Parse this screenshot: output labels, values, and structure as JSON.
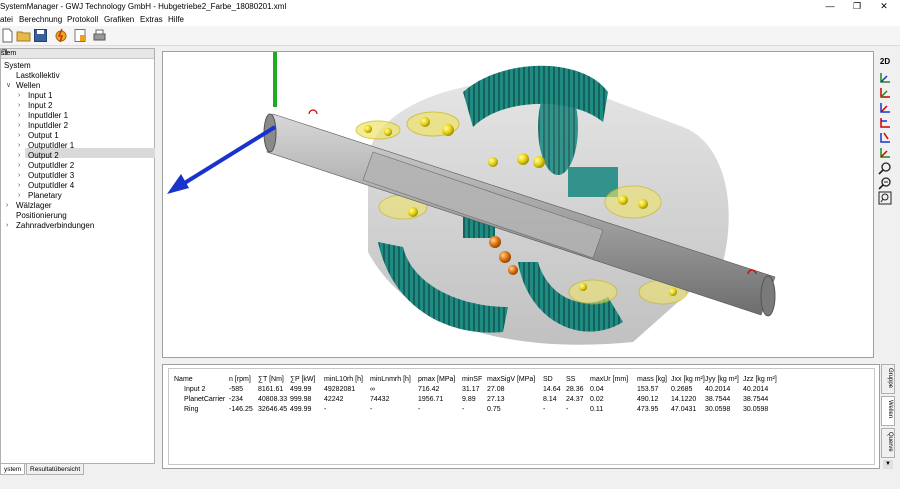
{
  "window": {
    "title": "SystemManager - GWJ Technology GmbH - Hubgetriebe2_Farbe_18080201.xml"
  },
  "menu": [
    "atei",
    "Berechnung",
    "Protokoll",
    "Grafiken",
    "Extras",
    "Hilfe"
  ],
  "panel": {
    "title": "stem"
  },
  "tree": [
    {
      "label": "System",
      "level": 0,
      "expander": ""
    },
    {
      "label": "Lastkollektiv",
      "level": 1,
      "expander": ""
    },
    {
      "label": "Wellen",
      "level": 1,
      "expander": "v"
    },
    {
      "label": "Input 1",
      "level": 2,
      "expander": ">"
    },
    {
      "label": "Input 2",
      "level": 2,
      "expander": ">"
    },
    {
      "label": "InputIdler 1",
      "level": 2,
      "expander": ">"
    },
    {
      "label": "InputIdler 2",
      "level": 2,
      "expander": ">"
    },
    {
      "label": "Output 1",
      "level": 2,
      "expander": ">"
    },
    {
      "label": "OutputIdler 1",
      "level": 2,
      "expander": ">"
    },
    {
      "label": "Output 2",
      "level": 2,
      "expander": ">"
    },
    {
      "label": "OutputIdler 2",
      "level": 2,
      "expander": ">"
    },
    {
      "label": "OutputIdler 3",
      "level": 2,
      "expander": ">"
    },
    {
      "label": "OutputIdler 4",
      "level": 2,
      "expander": ">"
    },
    {
      "label": "Planetary",
      "level": 2,
      "expander": ">"
    },
    {
      "label": "Wälzlager",
      "level": 1,
      "expander": ">"
    },
    {
      "label": "Positionierung",
      "level": 1,
      "expander": ""
    },
    {
      "label": "Zahnradverbindungen",
      "level": 1,
      "expander": ">"
    }
  ],
  "selected_tree_item": "Input 2",
  "bottom_tabs": [
    "ystem",
    "Resultatübersicht"
  ],
  "view_tools": {
    "mode_label": "2D"
  },
  "results": {
    "columns": [
      "Name",
      "n [rpm]",
      "∑T [Nm]",
      "∑P [kW]",
      "minL10rh [h]",
      "minLnmrh [h]",
      "pmax [MPa]",
      "minSF",
      "maxSigV [MPa]",
      "SD",
      "SS",
      "maxUr [mm]",
      "mass [kg]",
      "Jxx [kg m²]",
      "Jyy [kg m²]",
      "Jzz [kg m²]"
    ],
    "rows": [
      [
        "Input 2",
        "-585",
        "8161.61",
        "499.99",
        "49282081",
        "∞",
        "716.42",
        "31.17",
        "27.08",
        "14.64",
        "28.36",
        "0.04",
        "153.57",
        "0.2685",
        "40.2014",
        "40.2014"
      ],
      [
        "PlanetCarrier",
        "-234",
        "40808.33",
        "999.98",
        "42242",
        "74432",
        "1956.71",
        "9.89",
        "27.13",
        "8.14",
        "24.37",
        "0.02",
        "490.12",
        "14.1220",
        "38.7544",
        "38.7544"
      ],
      [
        "Ring",
        "-146.25",
        "32646.45",
        "499.99",
        "-",
        "-",
        "-",
        "-",
        "0.75",
        "-",
        "-",
        "0.11",
        "473.95",
        "47.0431",
        "30.0598",
        "30.0598"
      ]
    ]
  },
  "side_tabs": [
    "Gruppe",
    "Wellen",
    "Querve"
  ],
  "colors": {
    "gear": "#1f8c84",
    "bearing": "#e6d21e",
    "shaft": "#9a9a9a",
    "axis_x": "#1a33cc",
    "axis_y": "#22aa22"
  }
}
